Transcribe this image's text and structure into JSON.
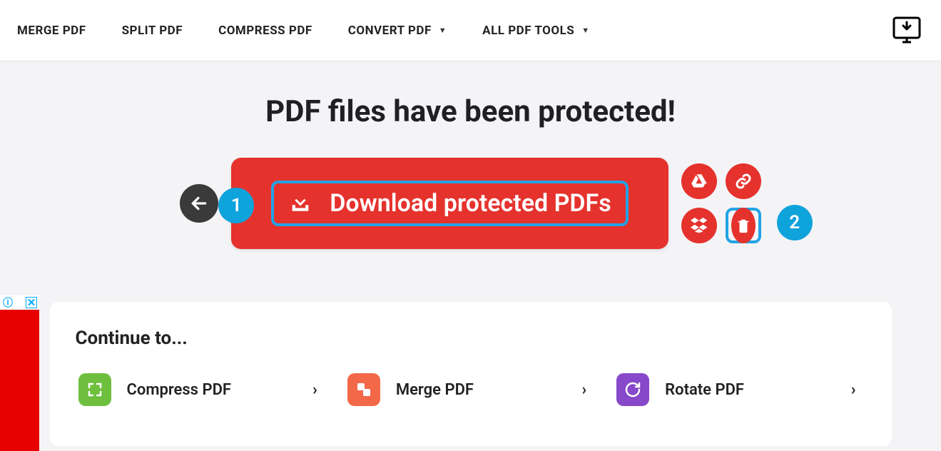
{
  "nav": {
    "items": [
      {
        "label": "MERGE PDF",
        "dropdown": false
      },
      {
        "label": "SPLIT PDF",
        "dropdown": false
      },
      {
        "label": "COMPRESS PDF",
        "dropdown": false
      },
      {
        "label": "CONVERT PDF",
        "dropdown": true
      },
      {
        "label": "ALL PDF TOOLS",
        "dropdown": true
      }
    ]
  },
  "main": {
    "title": "PDF files have been protected!",
    "download_label": "Download protected PDFs",
    "badges": {
      "one": "1",
      "two": "2"
    }
  },
  "continue": {
    "title": "Continue to...",
    "items": [
      {
        "label": "Compress PDF",
        "icon": "compress"
      },
      {
        "label": "Merge PDF",
        "icon": "merge"
      },
      {
        "label": "Rotate PDF",
        "icon": "rotate"
      }
    ]
  }
}
